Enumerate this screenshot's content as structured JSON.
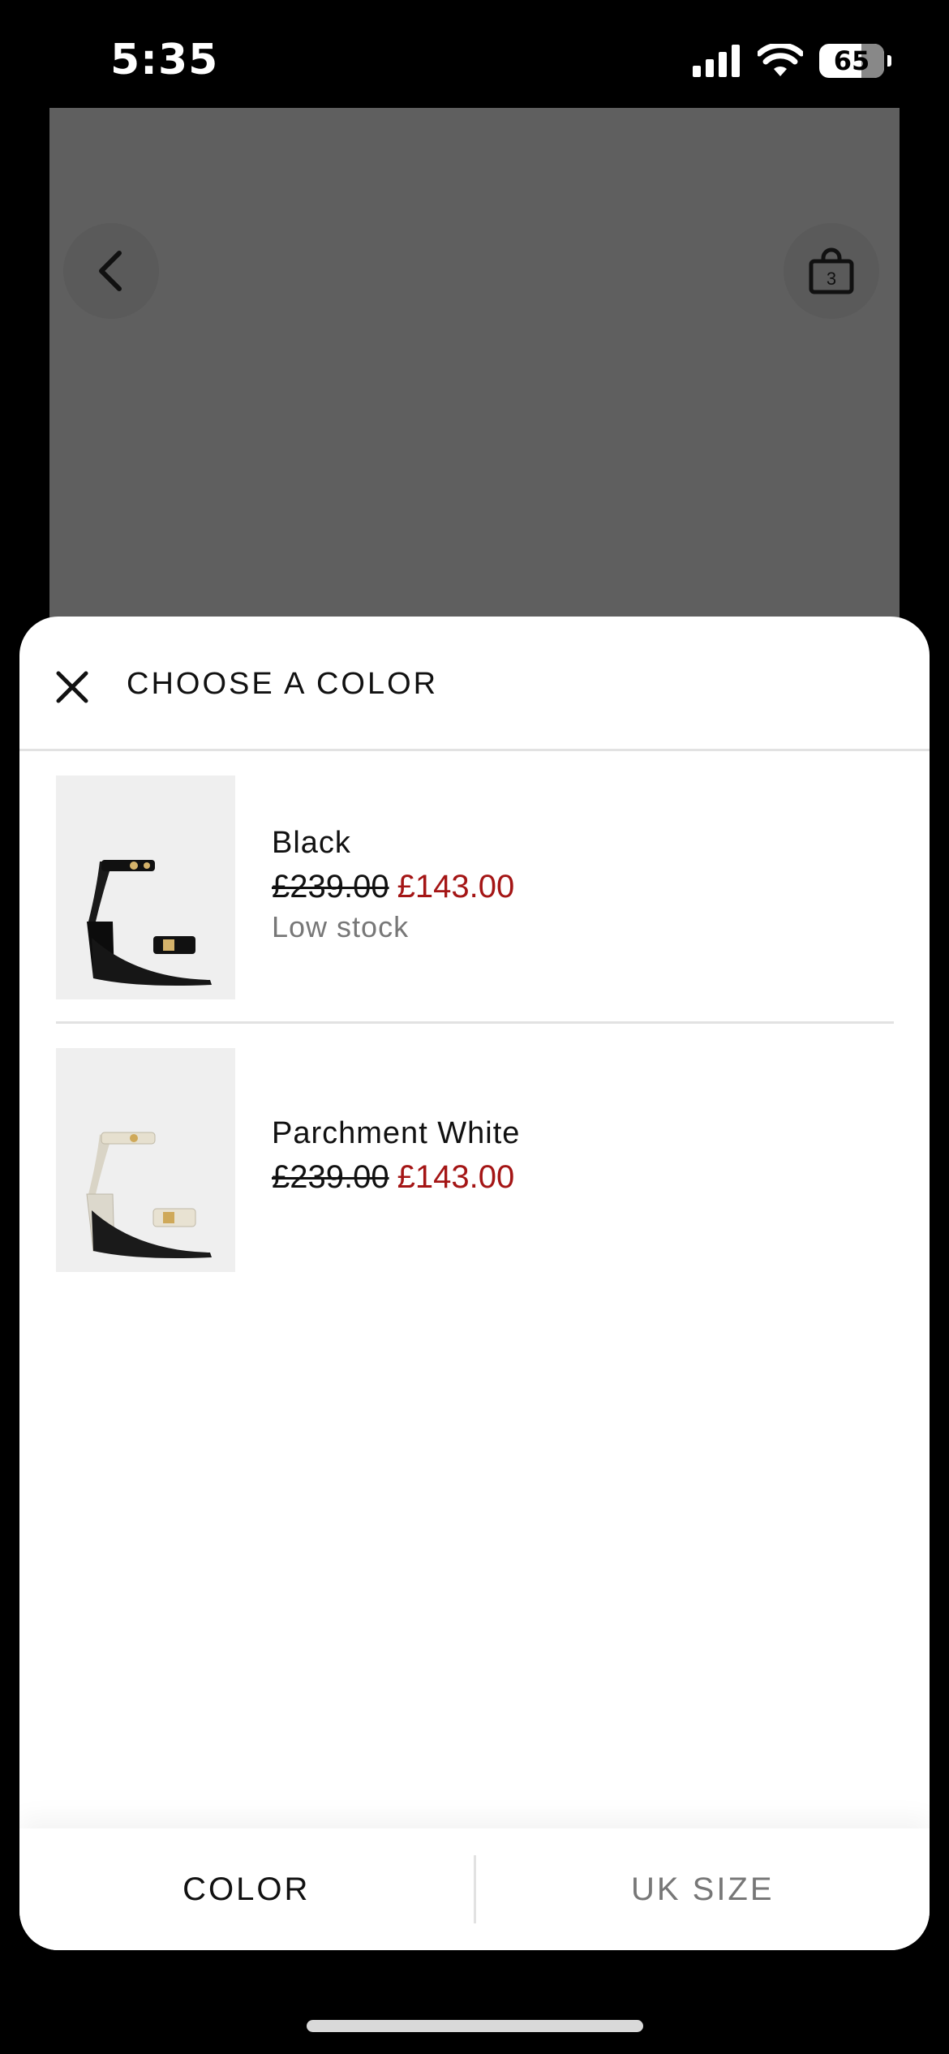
{
  "status_bar": {
    "time": "5:35",
    "battery": "65",
    "icons": [
      "signal-icon",
      "wifi-icon",
      "battery-icon"
    ]
  },
  "background": {
    "back_icon": "chevron-left-icon",
    "bag_icon": "shopping-bag-icon",
    "bag_count": "3"
  },
  "sheet": {
    "title": "CHOOSE A COLOR",
    "close_icon": "close-icon",
    "colors": [
      {
        "name": "Black",
        "price_old": "£239.00",
        "price_new": "£143.00",
        "stock": "Low stock"
      },
      {
        "name": "Parchment White",
        "price_old": "£239.00",
        "price_new": "£143.00",
        "stock": ""
      }
    ]
  },
  "tabs": {
    "color": "COLOR",
    "size": "UK SIZE"
  },
  "colors": {
    "sale_red": "#a41515",
    "overlay_gray": "#5f5f5f"
  }
}
